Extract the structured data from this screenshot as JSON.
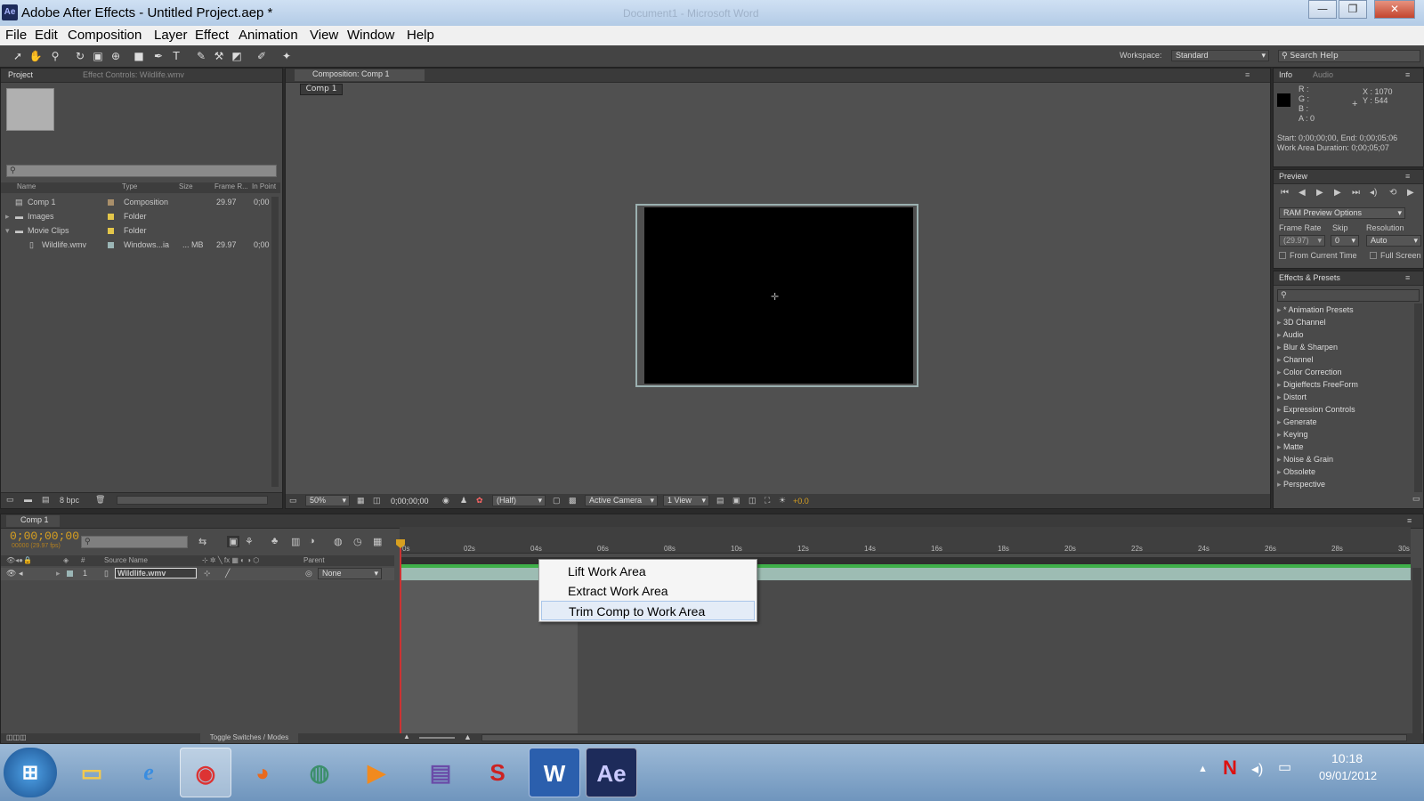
{
  "window": {
    "title": "Adobe After Effects - Untitled Project.aep *",
    "app_icon": "Ae",
    "background_window_title": "Document1 - Microsoft Word"
  },
  "menu": [
    "File",
    "Edit",
    "Composition",
    "Layer",
    "Effect",
    "Animation",
    "View",
    "Window",
    "Help"
  ],
  "toolbar": {
    "workspace_label": "Workspace:",
    "workspace_value": "Standard",
    "search_placeholder": "Search Help"
  },
  "project_panel": {
    "tab_project": "Project",
    "tab_effect_controls": "Effect Controls: Wildlife.wmv",
    "columns": [
      "Name",
      "Type",
      "Size",
      "Frame R...",
      "In Point"
    ],
    "rows": [
      {
        "name": "Comp 1",
        "type": "Composition",
        "size": "",
        "frame_rate": "29.97",
        "in_point": "0;00",
        "color": "#a98f6a"
      },
      {
        "name": "Images",
        "type": "Folder",
        "size": "",
        "frame_rate": "",
        "in_point": "",
        "color": "#e3c64a"
      },
      {
        "name": "Movie Clips",
        "type": "Folder",
        "size": "",
        "frame_rate": "",
        "in_point": "",
        "color": "#e3c64a"
      },
      {
        "name": "Wildlife.wmv",
        "type": "Windows...ia",
        "size": "... MB",
        "frame_rate": "29.97",
        "in_point": "0;00",
        "color": "#9bb6b6"
      }
    ],
    "bpc": "8 bpc"
  },
  "composition_panel": {
    "tab": "Composition: Comp 1",
    "breadcrumb": "Comp 1",
    "zoom": "50%",
    "timecode": "0;00;00;00",
    "resolution": "(Half)",
    "camera": "Active Camera",
    "view": "1 View",
    "exposure": "+0.0"
  },
  "info_panel": {
    "tab_info": "Info",
    "tab_audio": "Audio",
    "r": "R :",
    "g": "G :",
    "b": "B :",
    "a": "A : 0",
    "x": "X : 1070",
    "y": "Y : 544",
    "start_end": "Start: 0;00;00;00, End: 0;00;05;06",
    "work_area": "Work Area Duration: 0;00;05;07"
  },
  "preview_panel": {
    "tab": "Preview",
    "ram_options": "RAM Preview Options",
    "frame_rate_label": "Frame Rate",
    "skip_label": "Skip",
    "resolution_label": "Resolution",
    "frame_rate_value": "(29.97)",
    "skip_value": "0",
    "resolution_value": "Auto",
    "from_current": "From Current Time",
    "full_screen": "Full Screen"
  },
  "effects_panel": {
    "tab": "Effects & Presets",
    "items": [
      "* Animation Presets",
      "3D Channel",
      "Audio",
      "Blur & Sharpen",
      "Channel",
      "Color Correction",
      "Digieffects FreeForm",
      "Distort",
      "Expression Controls",
      "Generate",
      "Keying",
      "Matte",
      "Noise & Grain",
      "Obsolete",
      "Perspective"
    ]
  },
  "timeline": {
    "tab": "Comp 1",
    "timecode": "0;00;00;00",
    "fps": "00000 (29.97 fps)",
    "col_source": "Source Name",
    "col_parent": "Parent",
    "layer_num": "1",
    "layer_name": "Wildlife.wmv",
    "parent_value": "None",
    "toggle": "Toggle Switches / Modes",
    "ruler": [
      "0s",
      "02s",
      "04s",
      "06s",
      "08s",
      "10s",
      "12s",
      "14s",
      "16s",
      "18s",
      "20s",
      "22s",
      "24s",
      "26s",
      "28s",
      "30s"
    ]
  },
  "context_menu": {
    "items": [
      "Lift Work Area",
      "Extract Work Area",
      "Trim Comp to Work Area"
    ]
  },
  "taskbar": {
    "apps": [
      "start-orb",
      "explorer",
      "internet-explorer",
      "chrome",
      "firefox",
      "app-globe",
      "media-player",
      "app-stack",
      "app-sbp",
      "word",
      "after-effects"
    ],
    "time": "10:18",
    "date": "09/01/2012"
  }
}
